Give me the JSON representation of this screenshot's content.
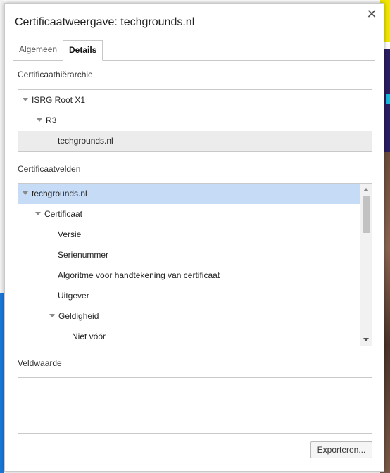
{
  "dialog": {
    "title": "Certificaatweergave: techgrounds.nl",
    "close_icon": "close-icon"
  },
  "tabs": [
    {
      "label": "Algemeen",
      "active": false
    },
    {
      "label": "Details",
      "active": true
    }
  ],
  "hierarchy": {
    "label": "Certificaathiërarchie",
    "items": [
      {
        "label": "ISRG Root X1",
        "expanded": true,
        "selected": false
      },
      {
        "label": "R3",
        "expanded": true,
        "selected": false
      },
      {
        "label": "techgrounds.nl",
        "expanded": false,
        "selected": true
      }
    ]
  },
  "fields": {
    "label": "Certificaatvelden",
    "items": [
      {
        "label": "techgrounds.nl",
        "expanded": true,
        "selected": true
      },
      {
        "label": "Certificaat",
        "expanded": true,
        "selected": false
      },
      {
        "label": "Versie",
        "expanded": false,
        "selected": false
      },
      {
        "label": "Serienummer",
        "expanded": false,
        "selected": false
      },
      {
        "label": "Algoritme voor handtekening van certificaat",
        "expanded": false,
        "selected": false
      },
      {
        "label": "Uitgever",
        "expanded": false,
        "selected": false
      },
      {
        "label": "Geldigheid",
        "expanded": true,
        "selected": false
      },
      {
        "label": "Niet vóór",
        "expanded": false,
        "selected": false
      }
    ]
  },
  "field_value": {
    "label": "Veldwaarde",
    "value": ""
  },
  "export_button": {
    "label": "Exporteren..."
  },
  "colors": {
    "selection_blue": "#c5dbf6",
    "selection_gray": "#ececec"
  }
}
